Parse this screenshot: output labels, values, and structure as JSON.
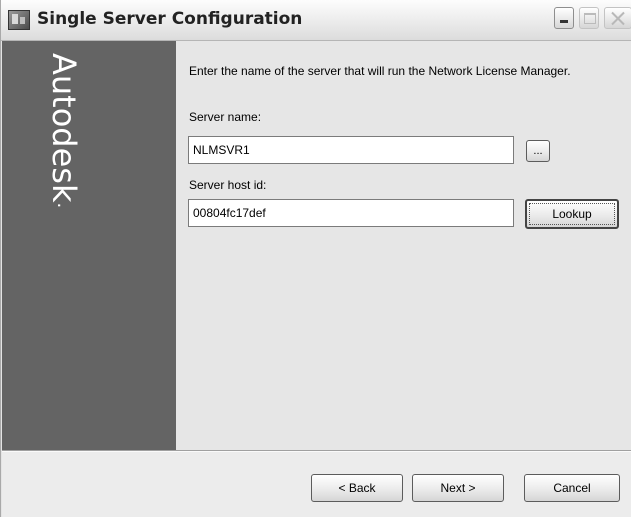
{
  "window": {
    "title": "Single Server Configuration",
    "icon": "app-icon",
    "controls": [
      "minimize-icon",
      "maximize-icon",
      "close-icon"
    ]
  },
  "sidebar": {
    "brand": "Autodesk",
    "brand_mark": "·",
    "background": "#646464"
  },
  "main": {
    "intro": "Enter the name of the server that will run the Network License Manager.",
    "server_name_label": "Server name:",
    "server_name_value": "NLMSVR1",
    "browse_label": "...",
    "host_id_label": "Server host id:",
    "host_id_value": "00804fc17def",
    "lookup_label": "Lookup"
  },
  "footer": {
    "back_label": "< Back",
    "next_label": "Next >",
    "cancel_label": "Cancel"
  }
}
